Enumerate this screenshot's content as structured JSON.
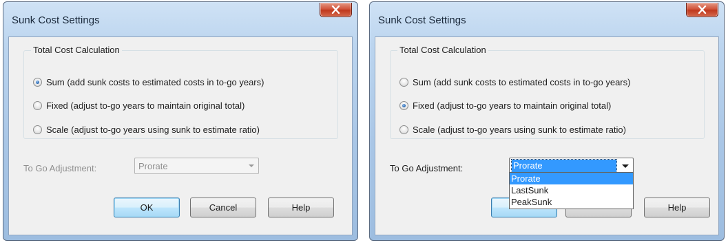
{
  "dialogs": [
    {
      "title": "Sunk Cost Settings",
      "group_label": "Total Cost Calculation",
      "options": [
        {
          "label": "Sum (add sunk costs to estimated costs in to-go years)",
          "checked": true
        },
        {
          "label": "Fixed (adjust to-go years to maintain original total)",
          "checked": false
        },
        {
          "label": "Scale (adjust to-go years using sunk to estimate ratio)",
          "checked": false
        }
      ],
      "adjustment_label": "To Go Adjustment:",
      "adjustment_value": "Prorate",
      "adjustment_enabled": false,
      "buttons": {
        "ok": "OK",
        "cancel": "Cancel",
        "help": "Help"
      }
    },
    {
      "title": "Sunk Cost Settings",
      "group_label": "Total Cost Calculation",
      "options": [
        {
          "label": "Sum (add sunk costs to estimated costs in to-go years)",
          "checked": false
        },
        {
          "label": "Fixed (adjust to-go years to maintain original total)",
          "checked": true
        },
        {
          "label": "Scale (adjust to-go years using sunk to estimate ratio)",
          "checked": false
        }
      ],
      "adjustment_label": "To Go Adjustment:",
      "adjustment_value": "Prorate",
      "adjustment_enabled": true,
      "dropdown_options": [
        "Prorate",
        "LastSunk",
        "PeakSunk"
      ],
      "dropdown_selected": "Prorate",
      "buttons": {
        "help": "Help"
      }
    }
  ],
  "icons": {
    "close": "close-x-icon",
    "dropdown": "chevron-down-icon"
  },
  "colors": {
    "selection": "#3399ff",
    "close_button": "#c9432a",
    "frame": "#a9c6e6"
  }
}
